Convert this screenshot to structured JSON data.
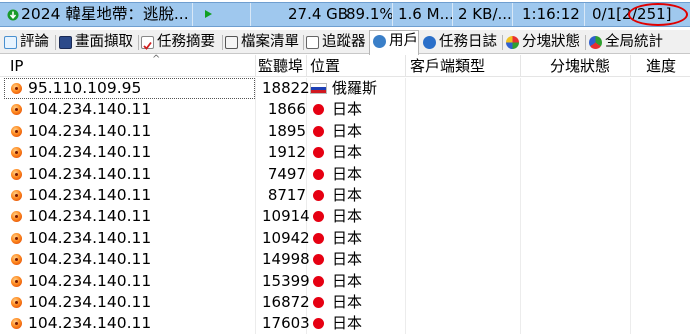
{
  "task": {
    "name": "2024 韓星地帶：逃脫...",
    "size": "27.4 GB",
    "progress": "89.1%",
    "transferred": "1.6 M...",
    "speed": "2 KB/...",
    "time_left": "1:16:12",
    "sources": "0/1[2",
    "sources_highlight": "/251]",
    "colors": {
      "row_bg": "#9fc8ee",
      "highlight_ring": "#e00000"
    },
    "icons": {
      "status": "download-arrow-icon",
      "play": "play-icon"
    }
  },
  "tabs": [
    {
      "label": "評論",
      "icon": "comment-icon"
    },
    {
      "label": "畫面擷取",
      "icon": "screenshot-icon"
    },
    {
      "label": "任務摘要",
      "icon": "task-summary-icon"
    },
    {
      "label": "檔案清單",
      "icon": "file-list-icon"
    },
    {
      "label": "追蹤器",
      "icon": "tracker-icon"
    },
    {
      "label": "用戶",
      "icon": "users-icon",
      "active": true
    },
    {
      "label": "任務日誌",
      "icon": "info-icon"
    },
    {
      "label": "分塊狀態",
      "icon": "piece-status-icon"
    },
    {
      "label": "全局統計",
      "icon": "global-stats-icon"
    }
  ],
  "columns": {
    "ip": "IP",
    "port": "監聽埠",
    "location": "位置",
    "client": "客戶端類型",
    "pieces": "分塊狀態",
    "progress": "進度"
  },
  "peers": [
    {
      "ip": "95.110.109.95",
      "port": "18822",
      "location": "俄羅斯",
      "flag": "russia-flag-icon"
    },
    {
      "ip": "104.234.140.11",
      "port": "1866",
      "location": "日本",
      "flag": "japan-flag-icon"
    },
    {
      "ip": "104.234.140.11",
      "port": "1895",
      "location": "日本",
      "flag": "japan-flag-icon"
    },
    {
      "ip": "104.234.140.11",
      "port": "1912",
      "location": "日本",
      "flag": "japan-flag-icon"
    },
    {
      "ip": "104.234.140.11",
      "port": "7497",
      "location": "日本",
      "flag": "japan-flag-icon"
    },
    {
      "ip": "104.234.140.11",
      "port": "8717",
      "location": "日本",
      "flag": "japan-flag-icon"
    },
    {
      "ip": "104.234.140.11",
      "port": "10914",
      "location": "日本",
      "flag": "japan-flag-icon"
    },
    {
      "ip": "104.234.140.11",
      "port": "10942",
      "location": "日本",
      "flag": "japan-flag-icon"
    },
    {
      "ip": "104.234.140.11",
      "port": "14998",
      "location": "日本",
      "flag": "japan-flag-icon"
    },
    {
      "ip": "104.234.140.11",
      "port": "15399",
      "location": "日本",
      "flag": "japan-flag-icon"
    },
    {
      "ip": "104.234.140.11",
      "port": "16872",
      "location": "日本",
      "flag": "japan-flag-icon"
    },
    {
      "ip": "104.234.140.11",
      "port": "17603",
      "location": "日本",
      "flag": "japan-flag-icon"
    }
  ]
}
